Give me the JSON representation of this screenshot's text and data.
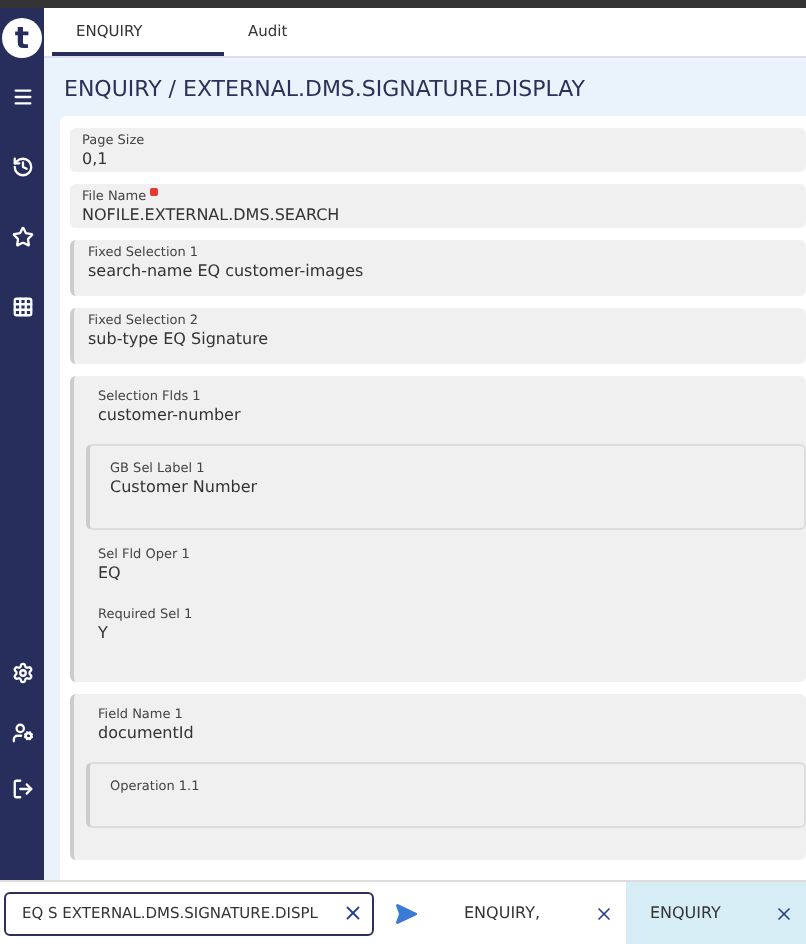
{
  "logo": "t",
  "tabs": [
    {
      "label": "ENQUIRY",
      "selected": true
    },
    {
      "label": "Audit",
      "selected": false
    }
  ],
  "title": "ENQUIRY / EXTERNAL.DMS.SIGNATURE.DISPLAY",
  "fields": [
    {
      "kind": "single",
      "label": "Page Size",
      "value": "0,1",
      "required": false
    },
    {
      "kind": "single",
      "label": "File Name",
      "value": "NOFILE.EXTERNAL.DMS.SEARCH",
      "required": true
    },
    {
      "kind": "multi",
      "label": "Fixed Selection 1",
      "value": "search-name EQ customer-images"
    },
    {
      "kind": "multi",
      "label": "Fixed Selection 2",
      "value": "sub-type EQ Signature"
    },
    {
      "kind": "group",
      "label": "Selection Flds 1",
      "value": "customer-number",
      "children": [
        {
          "kind": "multi",
          "label": "GB Sel Label 1",
          "value": "Customer Number"
        },
        {
          "kind": "row",
          "label": "Sel Fld Oper 1",
          "value": "EQ"
        },
        {
          "kind": "row",
          "label": "Required Sel 1",
          "value": "Y"
        }
      ]
    },
    {
      "kind": "group",
      "label": "Field Name 1",
      "value": "documentId",
      "children": [
        {
          "kind": "multi",
          "label": "Operation 1.1"
        }
      ]
    }
  ],
  "command": {
    "value": "EQ S EXTERNAL.DMS.SIGNATURE.DISPL"
  },
  "open_tabs": [
    {
      "label": "ENQUIRY,",
      "selected": false
    },
    {
      "label": "ENQUIRY",
      "selected": true
    }
  ]
}
